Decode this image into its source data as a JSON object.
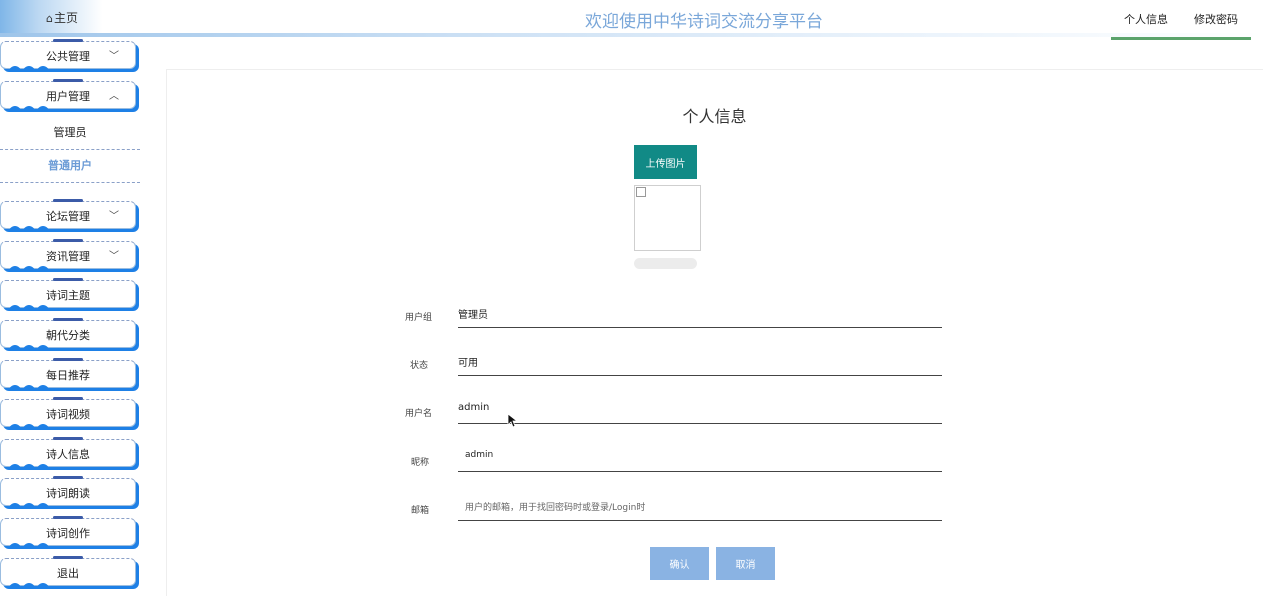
{
  "header": {
    "home_icon": "⌂",
    "home_label": "主页",
    "title": "欢迎使用中华诗词交流分享平台",
    "nav": [
      {
        "label": "个人信息"
      },
      {
        "label": "修改密码"
      }
    ]
  },
  "sidebar": {
    "menus": [
      {
        "label": "公共管理",
        "chevron": "﹀"
      },
      {
        "label": "用户管理",
        "chevron": "︿"
      },
      {
        "label": "论坛管理",
        "chevron": "﹀"
      },
      {
        "label": "资讯管理",
        "chevron": "﹀"
      },
      {
        "label": "诗词主题"
      },
      {
        "label": "朝代分类"
      },
      {
        "label": "每日推荐"
      },
      {
        "label": "诗词视频"
      },
      {
        "label": "诗人信息"
      },
      {
        "label": "诗词朗读"
      },
      {
        "label": "诗词创作"
      },
      {
        "label": "退出"
      }
    ],
    "submenu": [
      {
        "label": "管理员"
      },
      {
        "label": "普通用户"
      }
    ]
  },
  "main": {
    "title": "个人信息",
    "upload_label": "上传图片",
    "upload_progress": 0,
    "fields": {
      "group": {
        "label": "用户组",
        "value": "管理员"
      },
      "status": {
        "label": "状态",
        "value": "可用"
      },
      "username": {
        "label": "用户名",
        "value": "admin"
      },
      "nickname": {
        "label": "昵称",
        "value": "admin"
      },
      "email": {
        "label": "邮箱",
        "placeholder": "用户的邮箱，用于找回密码时或登录/Login时"
      }
    },
    "confirm_label": "确认",
    "cancel_label": "取消"
  },
  "colors": {
    "accent_blue": "#1e80e6",
    "title_blue": "#7aa7d9",
    "upload_teal": "#118a86",
    "button_blue": "#8ab3e3",
    "nav_underline": "#5ba36b"
  }
}
